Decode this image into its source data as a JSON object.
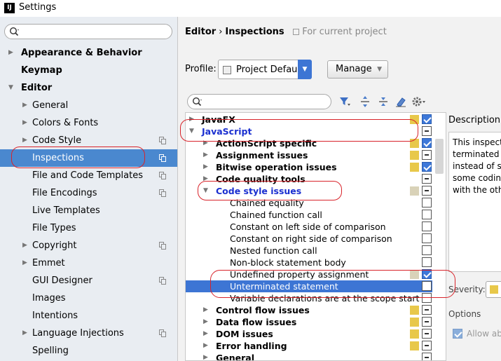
{
  "window": {
    "title": "Settings",
    "app_icon_text": "IJ"
  },
  "sidebar": {
    "search_placeholder": "",
    "items": [
      {
        "label": "Appearance & Behavior",
        "arrow": "▶",
        "bold": true,
        "indent": 0
      },
      {
        "label": "Keymap",
        "arrow": "",
        "bold": true,
        "indent": 0
      },
      {
        "label": "Editor",
        "arrow": "▼",
        "bold": true,
        "indent": 0
      },
      {
        "label": "General",
        "arrow": "▶",
        "indent": 1
      },
      {
        "label": "Colors & Fonts",
        "arrow": "▶",
        "indent": 1
      },
      {
        "label": "Code Style",
        "arrow": "▶",
        "indent": 1,
        "project": true
      },
      {
        "label": "Inspections",
        "arrow": "",
        "indent": 1,
        "project": true,
        "selected": true
      },
      {
        "label": "File and Code Templates",
        "arrow": "",
        "indent": 1,
        "project": true
      },
      {
        "label": "File Encodings",
        "arrow": "",
        "indent": 1,
        "project": true
      },
      {
        "label": "Live Templates",
        "arrow": "",
        "indent": 1
      },
      {
        "label": "File Types",
        "arrow": "",
        "indent": 1
      },
      {
        "label": "Copyright",
        "arrow": "▶",
        "indent": 1,
        "project": true
      },
      {
        "label": "Emmet",
        "arrow": "▶",
        "indent": 1
      },
      {
        "label": "GUI Designer",
        "arrow": "",
        "indent": 1,
        "project": true
      },
      {
        "label": "Images",
        "arrow": "",
        "indent": 1
      },
      {
        "label": "Intentions",
        "arrow": "",
        "indent": 1
      },
      {
        "label": "Language Injections",
        "arrow": "▶",
        "indent": 1,
        "project": true
      },
      {
        "label": "Spelling",
        "arrow": "",
        "indent": 1
      }
    ]
  },
  "breadcrumb": {
    "editor": "Editor",
    "sep": "›",
    "current": "Inspections",
    "scope": "For current project"
  },
  "profile": {
    "label": "Profile:",
    "value": "Project Default",
    "manage_label": "Manage"
  },
  "filter": {
    "placeholder": ""
  },
  "inspections": [
    {
      "label": "JavaFX",
      "arrow": "▶",
      "style": "bold",
      "indent": 0,
      "severity_color": "#e8c84a",
      "check": "checked"
    },
    {
      "label": "JavaScript",
      "arrow": "▼",
      "style": "blue",
      "indent": 0,
      "severity_color": "",
      "check": "partial"
    },
    {
      "label": "ActionScript specific",
      "arrow": "▶",
      "style": "bold",
      "indent": 1,
      "severity_color": "#e8c84a",
      "check": "checked"
    },
    {
      "label": "Assignment issues",
      "arrow": "▶",
      "style": "bold",
      "indent": 1,
      "severity_color": "#e8c84a",
      "check": "partial"
    },
    {
      "label": "Bitwise operation issues",
      "arrow": "▶",
      "style": "bold",
      "indent": 1,
      "severity_color": "#e8c84a",
      "check": "checked"
    },
    {
      "label": "Code quality tools",
      "arrow": "▶",
      "style": "bold",
      "indent": 1,
      "severity_color": "",
      "check": "partial"
    },
    {
      "label": "Code style issues",
      "arrow": "▼",
      "style": "blue",
      "indent": 1,
      "severity_color": "#d9d2b8",
      "check": "partial"
    },
    {
      "label": "Chained equality",
      "arrow": "",
      "style": "normal",
      "indent": 2,
      "severity_color": "",
      "check": "unchecked"
    },
    {
      "label": "Chained function call",
      "arrow": "",
      "style": "normal",
      "indent": 2,
      "severity_color": "",
      "check": "unchecked"
    },
    {
      "label": "Constant on left side of comparison",
      "arrow": "",
      "style": "normal",
      "indent": 2,
      "severity_color": "",
      "check": "unchecked"
    },
    {
      "label": "Constant on right side of comparison",
      "arrow": "",
      "style": "normal",
      "indent": 2,
      "severity_color": "",
      "check": "unchecked"
    },
    {
      "label": "Nested function call",
      "arrow": "",
      "style": "normal",
      "indent": 2,
      "severity_color": "",
      "check": "unchecked"
    },
    {
      "label": "Non-block statement body",
      "arrow": "",
      "style": "normal",
      "indent": 2,
      "severity_color": "",
      "check": "unchecked"
    },
    {
      "label": "Undefined property assignment",
      "arrow": "",
      "style": "normal",
      "indent": 2,
      "severity_color": "#d9d2b8",
      "check": "checked"
    },
    {
      "label": "Unterminated statement",
      "arrow": "",
      "style": "normal",
      "indent": 2,
      "severity_color": "",
      "check": "unchecked",
      "selected": true
    },
    {
      "label": "Variable declarations are at the scope start",
      "arrow": "",
      "style": "normal",
      "indent": 2,
      "severity_color": "",
      "check": "unchecked"
    },
    {
      "label": "Control flow issues",
      "arrow": "▶",
      "style": "bold",
      "indent": 1,
      "severity_color": "#e8c84a",
      "check": "partial"
    },
    {
      "label": "Data flow issues",
      "arrow": "▶",
      "style": "bold",
      "indent": 1,
      "severity_color": "#e8c84a",
      "check": "partial"
    },
    {
      "label": "DOM issues",
      "arrow": "▶",
      "style": "bold",
      "indent": 1,
      "severity_color": "#e8c84a",
      "check": "partial"
    },
    {
      "label": "Error handling",
      "arrow": "▶",
      "style": "bold",
      "indent": 1,
      "severity_color": "#e8c84a",
      "check": "partial"
    },
    {
      "label": "General",
      "arrow": "▶",
      "style": "bold",
      "indent": 1,
      "severity_color": "",
      "check": "partial"
    }
  ],
  "description": {
    "title": "Description",
    "lines": [
      "This inspect",
      "terminated l",
      "instead of se",
      "some coding",
      "with the othe"
    ]
  },
  "severity": {
    "label": "Severity:",
    "color": "#e8c84a"
  },
  "options": {
    "label": "Options",
    "allow_label": "Allow ab"
  },
  "colors": {
    "selection": "#3d75d4",
    "sidebar_selection": "#4a88cf",
    "annotation_red": "#d8232a",
    "group_blue": "#1a2fd0",
    "warning_yellow": "#e8c84a"
  }
}
